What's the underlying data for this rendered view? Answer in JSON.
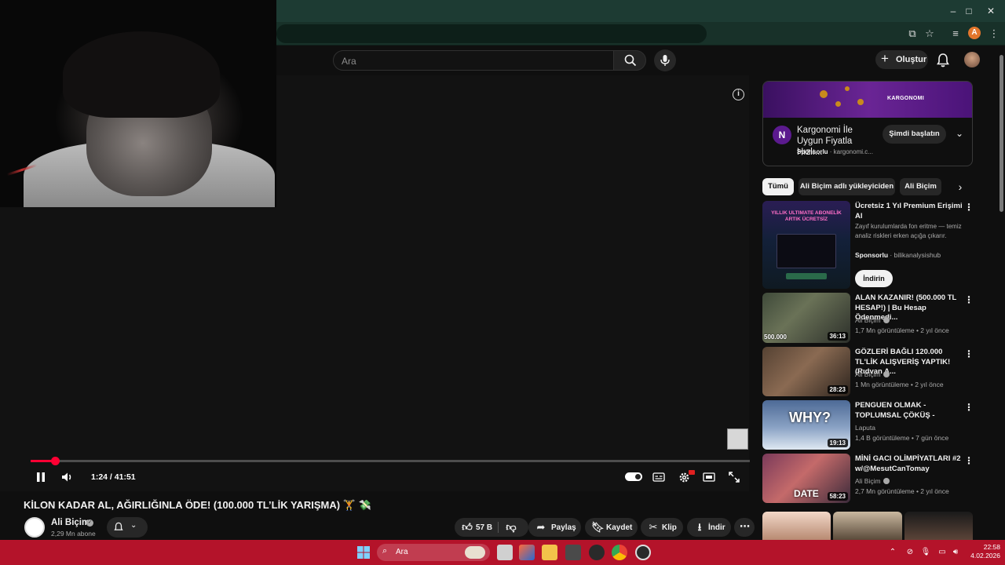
{
  "search": {
    "placeholder": "Ara"
  },
  "masthead": {
    "create_label": "Oluştur"
  },
  "player": {
    "time_display": "1:24 / 41:51",
    "progress_fraction": 0.0334
  },
  "video": {
    "title": "KİLON KADAR AL, AĞIRLIĞINLA ÖDE! (100.000 TL’LİK YARIŞMA) 🏋️ 💸",
    "channel_name": "Ali Biçim",
    "subscribers": "2,29 Mn abone",
    "likes": "57 B",
    "share_label": "Paylaş",
    "save_label": "Kaydet",
    "clip_label": "Klip",
    "download_label": "İndir"
  },
  "sidebar_ad": {
    "banner_brand": "KARGONOMI",
    "logo_letter": "N",
    "title": "Kargonomi İle Uygun Fiyatla Hızlı...",
    "sponsored": "Sponsorlu",
    "domain": "kargonomi.c...",
    "cta": "Şimdi başlatın"
  },
  "chips": [
    "Tümü",
    "Ali Biçim adlı yükleyiciden",
    "Ali Biçim"
  ],
  "promo": {
    "title": "Ücretsiz 1 Yıl Premium Erişimi Al",
    "description": "Zayıf kurulumlarda fon eritme — temiz analiz riskleri erken açığa çıkarır.",
    "sponsored": "Sponsorlu",
    "advertiser": "bilikanalysishub",
    "cta": "İndirin",
    "thumb_headline": "YILLIK ULTIMATE ABONELİK ARTIK ÜCRETSİZ"
  },
  "recommendations": [
    {
      "title": "ALAN KAZANIR! (500.000 TL HESAP!) | Bu Hesap Ödenmedi...",
      "channel": "Ali Biçim",
      "verified": true,
      "meta": "1,7 Mn görüntüleme • 2 yıl önce",
      "duration": "36:13",
      "badge": "500.000"
    },
    {
      "title": "GÖZLERİ BAĞLI 120.000 TL'LİK ALIŞVERİŞ YAPTIK! (Rıdvan A...",
      "channel": "Ali Biçim",
      "verified": true,
      "meta": "1 Mn görüntüleme • 2 yıl önce",
      "duration": "28:23",
      "badge": ""
    },
    {
      "title": "PENGUEN OLMAK - TOPLUMSAL ÇÖKÜŞ -",
      "channel": "Laputa",
      "verified": false,
      "meta": "1,4 B görüntüleme • 7 gün önce",
      "duration": "19:13",
      "badge": "WHY?"
    },
    {
      "title": "MİNİ GACI OLİMPİYATLARI #2 w/@MesutCanTomay",
      "channel": "Ali Biçim",
      "verified": true,
      "meta": "2,7 Mn görüntüleme • 2 yıl önce",
      "duration": "58:23",
      "badge": "DATE"
    }
  ],
  "taskbar": {
    "search_placeholder": "Ara",
    "time": "22:58",
    "date": "4.02.2026"
  },
  "colors": {
    "accent_red": "#ff0033",
    "taskbar": "#b4132a",
    "browser_frame": "#1d3b33"
  }
}
